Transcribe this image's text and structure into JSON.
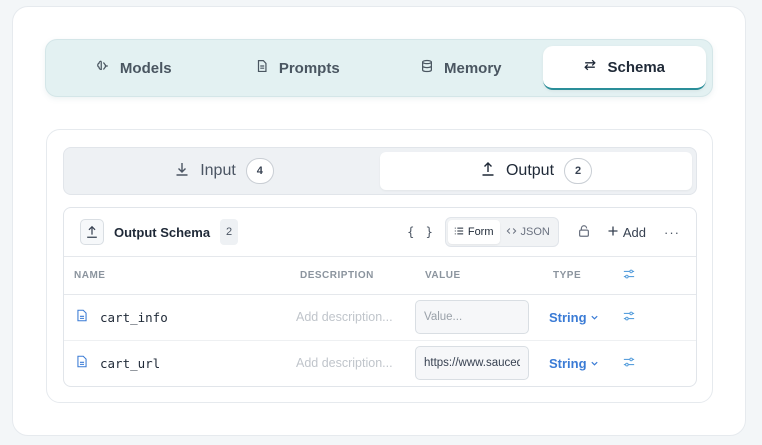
{
  "top_tabs": [
    {
      "label": "Models",
      "icon": "brain-icon",
      "active": false
    },
    {
      "label": "Prompts",
      "icon": "document-icon",
      "active": false
    },
    {
      "label": "Memory",
      "icon": "database-icon",
      "active": false
    },
    {
      "label": "Schema",
      "icon": "swap-arrows-icon",
      "active": true
    }
  ],
  "io_tabs": {
    "input": {
      "label": "Input",
      "count": "4"
    },
    "output": {
      "label": "Output",
      "count": "2"
    }
  },
  "schema": {
    "title": "Output Schema",
    "count": "2",
    "braces": "{ }",
    "form_label": "Form",
    "json_label": "JSON",
    "add_label": "Add",
    "more_label": "···"
  },
  "table": {
    "headers": {
      "name": "NAME",
      "description": "DESCRIPTION",
      "value": "VALUE",
      "type": "TYPE"
    },
    "rows": [
      {
        "name": "cart_info",
        "description_placeholder": "Add description...",
        "value": "",
        "value_placeholder": "Value...",
        "type": "String"
      },
      {
        "name": "cart_url",
        "description_placeholder": "Add description...",
        "value": "https://www.saucedemo.com/cart.html",
        "value_placeholder": "Value...",
        "type": "String"
      }
    ]
  },
  "colors": {
    "accent": "#2a8e99",
    "type_link": "#3a7bd5"
  }
}
